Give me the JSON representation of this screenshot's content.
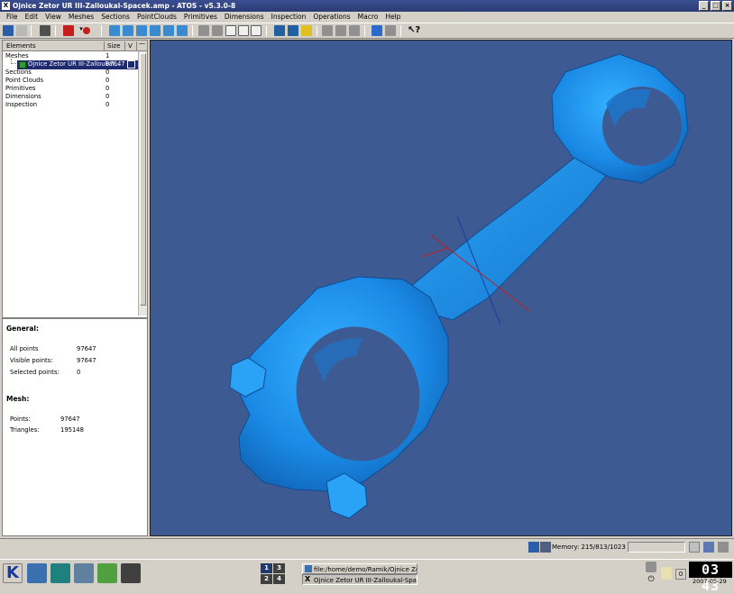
{
  "title_bar": {
    "title": "Ojnice Zetor UR III-Zalloukal-Spacek.amp - ATOS - v5.3.0-8",
    "app_icon": "X"
  },
  "menu": [
    "File",
    "Edit",
    "View",
    "Meshes",
    "Sections",
    "PointClouds",
    "Primitives",
    "Dimensions",
    "Inspection",
    "Operations",
    "Macro",
    "Help"
  ],
  "tree": {
    "headers": {
      "elements": "Elements",
      "size": "Size",
      "v": "V"
    },
    "rows": [
      {
        "label": "Meshes",
        "value": "1"
      },
      {
        "label": "Ojnice Zetor UR III-Zalloukal...",
        "value": "97647"
      },
      {
        "label": "Sections",
        "value": "0"
      },
      {
        "label": "Point Clouds",
        "value": "0"
      },
      {
        "label": "Primitives",
        "value": "0"
      },
      {
        "label": "Dimensions",
        "value": "0"
      },
      {
        "label": "Inspection",
        "value": "0"
      }
    ]
  },
  "info": {
    "general_title": "General:",
    "all_points_label": "All points",
    "all_points": "97647",
    "visible_points_label": "Visible points:",
    "visible_points": "97647",
    "selected_points_label": "Selected points:",
    "selected_points": "0",
    "mesh_title": "Mesh:",
    "points_label": "Points:",
    "points": "97647",
    "triangles_label": "Triangles:",
    "triangles": "195148"
  },
  "status": {
    "memory": "Memory: 215/813/1023 MB"
  },
  "taskbar": {
    "pager": [
      "1",
      "3",
      "2",
      "4"
    ],
    "tasks": [
      {
        "label": "file:/home/demo/Ramik/Ojnice Zetor U"
      },
      {
        "label": "Ojnice Zetor UR III-Zalloukal-Spa"
      }
    ],
    "tray_value": "0",
    "clock": "03 43",
    "date": "2007-05-29"
  },
  "colors": {
    "viewport_bg": "#3d5a92",
    "mesh": "#1e90e0",
    "title_bar": "#2c3b74"
  }
}
